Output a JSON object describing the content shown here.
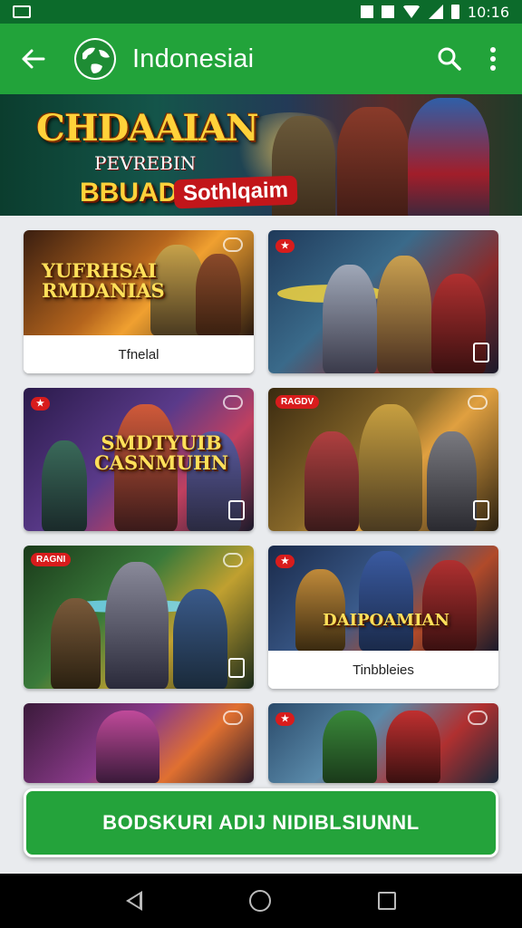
{
  "statusbar": {
    "time": "10:16"
  },
  "appbar": {
    "title": "Indonesiai"
  },
  "banner": {
    "line1": "CHDAAIAN",
    "line2": "PEVREBIN",
    "line3": "BBUAD",
    "line4": "Sothlqaim"
  },
  "cards": [
    {
      "title": "YUFRHSAI RMDANIAS",
      "label": "Tfnelal",
      "badge": ""
    },
    {
      "title": "",
      "label": "",
      "badge": ""
    },
    {
      "title": "SMDTYUIB CASNMUHN",
      "label": "",
      "badge": ""
    },
    {
      "title": "",
      "label": "",
      "badge": "RAGDV"
    },
    {
      "title": "",
      "label": "",
      "badge": "RAGNI"
    },
    {
      "title": "DAIPOAMIAN",
      "label": "Tinbbleies",
      "badge": ""
    },
    {
      "title": "",
      "label": "",
      "badge": ""
    },
    {
      "title": "",
      "label": "",
      "badge": ""
    }
  ],
  "cta": {
    "label": "BODSKURI ADIJ NIDIBLSIUNNL"
  },
  "colors": {
    "primary": "#22a33a",
    "statusbar": "#0c6b2b",
    "badge": "#d81c1c"
  }
}
